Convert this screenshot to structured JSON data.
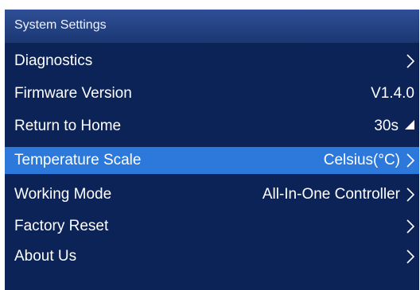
{
  "header": {
    "title": "System Settings"
  },
  "menu": {
    "items": [
      {
        "label": "Diagnostics",
        "value": "",
        "icon": "chevron-right-icon"
      },
      {
        "label": "Firmware Version",
        "value": "V1.4.0",
        "icon": ""
      },
      {
        "label": "Return to Home",
        "value": "30s",
        "icon": "triangle-corner-icon"
      },
      {
        "label": "Temperature Scale",
        "value": "Celsius(°C)",
        "icon": "chevron-right-icon",
        "selected": true
      },
      {
        "label": "Working Mode",
        "value": "All-In-One Controller",
        "icon": "chevron-right-icon"
      },
      {
        "label": "Factory Reset",
        "value": "",
        "icon": "chevron-right-icon"
      },
      {
        "label": "About Us",
        "value": "",
        "icon": "chevron-right-icon"
      }
    ]
  },
  "colors": {
    "background": "#0c2358",
    "header": "#24437f",
    "selected_row": "#2d78db",
    "text": "#ffffff"
  }
}
